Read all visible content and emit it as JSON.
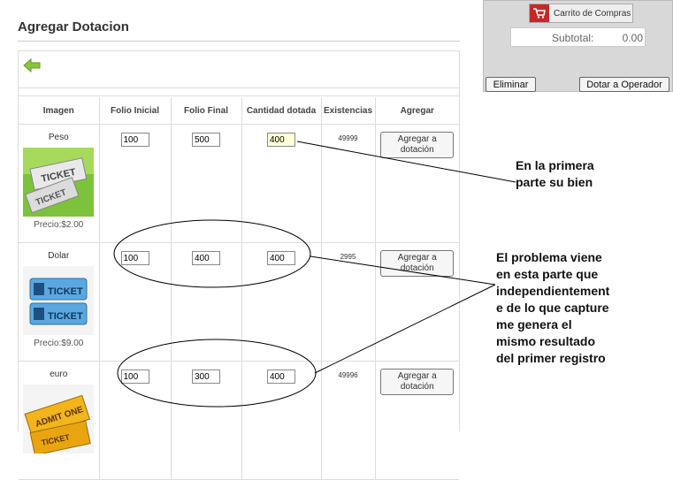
{
  "page": {
    "title": "Agregar Dotacion"
  },
  "table": {
    "headers": [
      "Imagen",
      "Folio Inicial",
      "Folio Final",
      "Cantidad dotada",
      "Existencias",
      "Agregar"
    ],
    "rows": [
      {
        "name": "Peso",
        "price": "Precio:$2.00",
        "folio_inicial": "100",
        "folio_final": "500",
        "cantidad": "400",
        "existencias": "49999",
        "button": "Agregar a dotación"
      },
      {
        "name": "Dolar",
        "price": "Precio:$9.00",
        "folio_inicial": "100",
        "folio_final": "400",
        "cantidad": "400",
        "existencias": "2995",
        "button": "Agregar a dotación"
      },
      {
        "name": "euro",
        "price": "",
        "folio_inicial": "100",
        "folio_final": "300",
        "cantidad": "400",
        "existencias": "49996",
        "button": "Agregar a dotación"
      }
    ]
  },
  "cart": {
    "button_label": "Carrito de Compras",
    "subtotal_label": "Subtotal:",
    "subtotal_value": "0.00",
    "eliminar": "Eliminar",
    "dotar": "Dotar a Operador"
  },
  "annotations": {
    "note1": [
      "En la primera",
      "parte su bien"
    ],
    "note2": [
      "El problema viene",
      "en esta parte que",
      "independientement",
      "e de lo que capture",
      "me genera el",
      "mismo resultado",
      "del primer registro"
    ]
  },
  "colors": {
    "accent": "#c62828",
    "arrow": "#7dbb2a",
    "highlight": "#ffffd8"
  },
  "icons": {
    "back": "back-arrow-icon",
    "cart": "cart-icon"
  }
}
